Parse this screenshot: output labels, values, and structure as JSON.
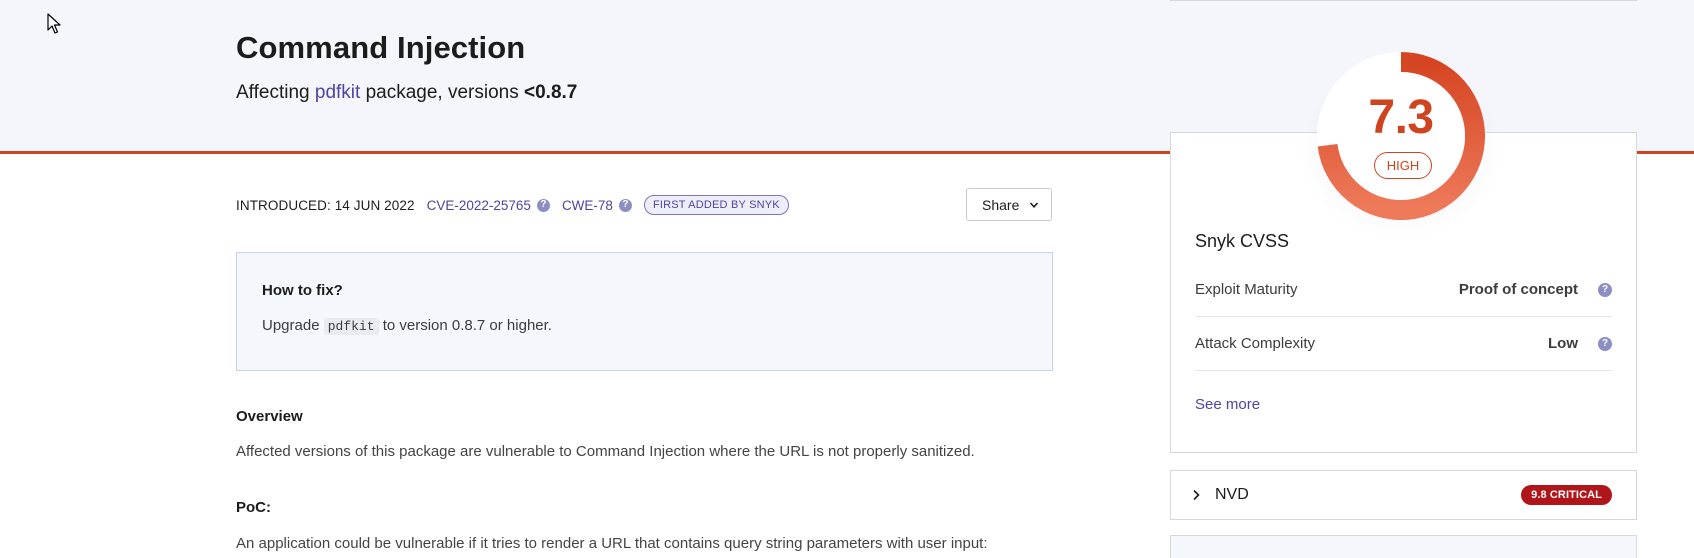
{
  "header": {
    "title": "Command Injection",
    "affecting_prefix": "Affecting ",
    "package_name": "pdfkit",
    "affecting_mid": " package, versions ",
    "versions": "<0.8.7"
  },
  "meta": {
    "introduced": "INTRODUCED: 14 JUN 2022",
    "cve": "CVE-2022-25765",
    "cwe": "CWE-78",
    "badge": "FIRST ADDED BY SNYK",
    "help_glyph": "?"
  },
  "share": {
    "label": "Share"
  },
  "fix": {
    "title": "How to fix?",
    "text_prefix": "Upgrade ",
    "code": "pdfkit",
    "text_suffix": " to version 0.8.7 or higher."
  },
  "overview": {
    "title": "Overview",
    "text": "Affected versions of this package are vulnerable to Command Injection where the URL is not properly sanitized."
  },
  "poc": {
    "title": "PoC:",
    "text": "An application could be vulnerable if it tries to render a URL that contains query string parameters with user input:"
  },
  "cvss": {
    "score": "7.3",
    "score_fraction": 0.73,
    "severity": "HIGH",
    "title": "Snyk CVSS",
    "rows": [
      {
        "label": "Exploit Maturity",
        "value": "Proof of concept"
      },
      {
        "label": "Attack Complexity",
        "value": "Low"
      }
    ],
    "see_more": "See more"
  },
  "nvd": {
    "label": "NVD",
    "badge": "9.8 CRITICAL"
  },
  "colors": {
    "accent": "#cf4420",
    "link": "#4b45a1",
    "critical": "#b0151a"
  }
}
